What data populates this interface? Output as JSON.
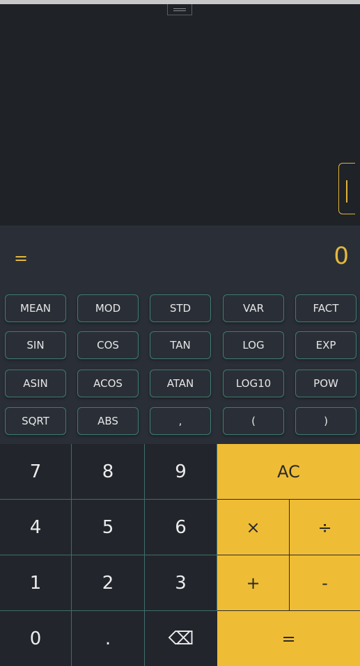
{
  "display": {
    "equals_sign": "=",
    "result": "0"
  },
  "scientific": {
    "row1": [
      "MEAN",
      "MOD",
      "STD",
      "VAR",
      "FACT"
    ],
    "row2": [
      "SIN",
      "COS",
      "TAN",
      "LOG",
      "EXP"
    ],
    "row3": [
      "ASIN",
      "ACOS",
      "ATAN",
      "LOG10",
      "POW"
    ],
    "row4": [
      "SQRT",
      "ABS",
      ",",
      "(",
      ")"
    ]
  },
  "keypad": {
    "seven": "7",
    "eight": "8",
    "nine": "9",
    "four": "4",
    "five": "5",
    "six": "6",
    "one": "1",
    "two": "2",
    "three": "3",
    "zero": "0",
    "decimal": ".",
    "backspace": "⌫",
    "clear": "AC",
    "multiply": "×",
    "divide": "÷",
    "add": "+",
    "subtract": "-",
    "equals": "="
  },
  "colors": {
    "accent": "#efbd35",
    "display_text": "#e5b83d",
    "background": "#22262c",
    "button_border": "#3f7b74"
  }
}
